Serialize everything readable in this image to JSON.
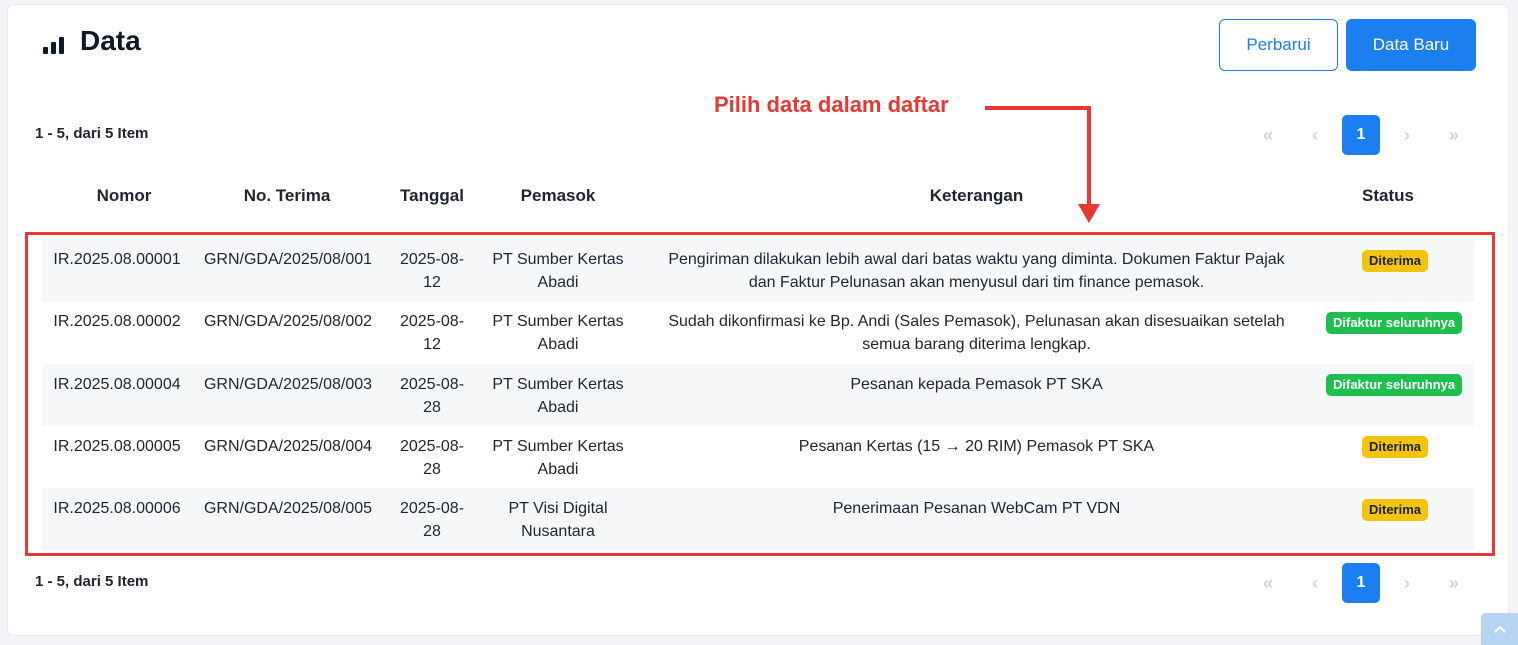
{
  "header": {
    "title": "Data",
    "icon": "bar-chart-icon",
    "refresh_label": "Perbarui",
    "new_label": "Data Baru"
  },
  "summary": "1 - 5, dari 5 Item",
  "pagination": {
    "first": "«",
    "prev": "‹",
    "current": "1",
    "next": "›",
    "last": "»"
  },
  "annotation": {
    "text": "Pilih data dalam daftar",
    "color": "#e53935"
  },
  "table": {
    "columns": [
      "Nomor",
      "No. Terima",
      "Tanggal",
      "Pemasok",
      "Keterangan",
      "Status"
    ],
    "rows": [
      {
        "nomor": "IR.2025.08.00001",
        "no_terima": "GRN/GDA/2025/08/001",
        "tanggal_1": "2025-08-",
        "tanggal_2": "12",
        "pemasok_1": "PT Sumber Kertas",
        "pemasok_2": "Abadi",
        "ket_1": "Pengiriman dilakukan lebih awal dari batas waktu yang diminta. Dokumen Faktur Pajak",
        "ket_2": "dan Faktur Pelunasan akan menyusul dari tim finance pemasok.",
        "status": "Diterima"
      },
      {
        "nomor": "IR.2025.08.00002",
        "no_terima": "GRN/GDA/2025/08/002",
        "tanggal_1": "2025-08-",
        "tanggal_2": "12",
        "pemasok_1": "PT Sumber Kertas",
        "pemasok_2": "Abadi",
        "ket_1": "Sudah dikonfirmasi ke Bp. Andi (Sales Pemasok), Pelunasan akan disesuaikan setelah",
        "ket_2": "semua barang diterima lengkap.",
        "status": "Difaktur seluruhnya"
      },
      {
        "nomor": "IR.2025.08.00004",
        "no_terima": "GRN/GDA/2025/08/003",
        "tanggal_1": "2025-08-",
        "tanggal_2": "28",
        "pemasok_1": "PT Sumber Kertas",
        "pemasok_2": "Abadi",
        "ket_1": "Pesanan kepada Pemasok PT SKA",
        "ket_2": "",
        "status": "Difaktur seluruhnya"
      },
      {
        "nomor": "IR.2025.08.00005",
        "no_terima": "GRN/GDA/2025/08/004",
        "tanggal_1": "2025-08-",
        "tanggal_2": "28",
        "pemasok_1": "PT Sumber Kertas",
        "pemasok_2": "Abadi",
        "ket_1": "Pesanan Kertas (15 → 20 RIM) Pemasok PT SKA",
        "ket_2": "",
        "status": "Diterima"
      },
      {
        "nomor": "IR.2025.08.00006",
        "no_terima": "GRN/GDA/2025/08/005",
        "tanggal_1": "2025-08-",
        "tanggal_2": "28",
        "pemasok_1": "PT Visi Digital",
        "pemasok_2": "Nusantara",
        "ket_1": "Penerimaan Pesanan WebCam PT VDN",
        "ket_2": "",
        "status": "Diterima"
      }
    ]
  },
  "colors": {
    "primary": "#1b7ff0",
    "status_received": "#f1c40f",
    "status_invoiced": "#1fbf4f"
  }
}
